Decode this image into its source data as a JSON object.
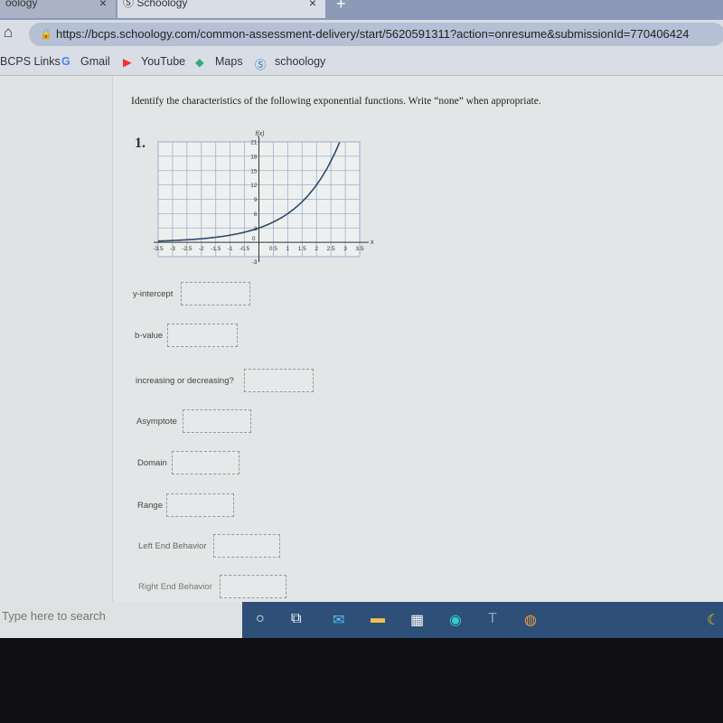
{
  "browser": {
    "tabs": [
      {
        "label": "oology"
      },
      {
        "label": "Schoology",
        "active": true
      }
    ],
    "url": "https://bcps.schoology.com/common-assessment-delivery/start/5620591311?action=onresume&submissionId=770406424",
    "bookmarks": [
      "BCPS Links",
      "Gmail",
      "YouTube",
      "Maps",
      "schoology"
    ]
  },
  "question": {
    "instructions": "Identify the characteristics of the following exponential functions. Write “none” when appropriate.",
    "number": "1.",
    "fields": [
      {
        "label": "y-intercept",
        "value": ""
      },
      {
        "label": "b-value",
        "value": ""
      },
      {
        "label": "increasing or decreasing?",
        "value": ""
      },
      {
        "label": "Asymptote",
        "value": ""
      },
      {
        "label": "Domain",
        "value": ""
      },
      {
        "label": "Range",
        "value": ""
      },
      {
        "label": "Left End Behavior",
        "value": ""
      },
      {
        "label": "Right End Behavior",
        "value": ""
      }
    ]
  },
  "chart_data": {
    "type": "line",
    "xlabel": "x",
    "ylabel": "f(x)",
    "xlim": [
      -3.5,
      3.5
    ],
    "ylim": [
      -3,
      21
    ],
    "x_ticks": [
      "-3.5",
      "-3",
      "-2.5",
      "-2",
      "-1.5",
      "-1",
      "-0.5",
      "0",
      "0.5",
      "1",
      "1.5",
      "2",
      "2.5",
      "3",
      "3.5"
    ],
    "y_ticks": [
      "-3",
      "3",
      "6",
      "9",
      "12",
      "15",
      "18",
      "21"
    ],
    "grid": true,
    "x": [
      -3.5,
      -3,
      -2,
      -1,
      0,
      1,
      2,
      2.8
    ],
    "y": [
      0.27,
      0.38,
      0.75,
      1.5,
      3,
      6,
      12,
      20.9
    ],
    "color": "#2d4a6a"
  },
  "taskbar": {
    "search_placeholder": "Type here to search",
    "apps": [
      "cortana",
      "task-view",
      "mail",
      "file-explorer",
      "store",
      "edge",
      "teams",
      "chrome"
    ]
  }
}
